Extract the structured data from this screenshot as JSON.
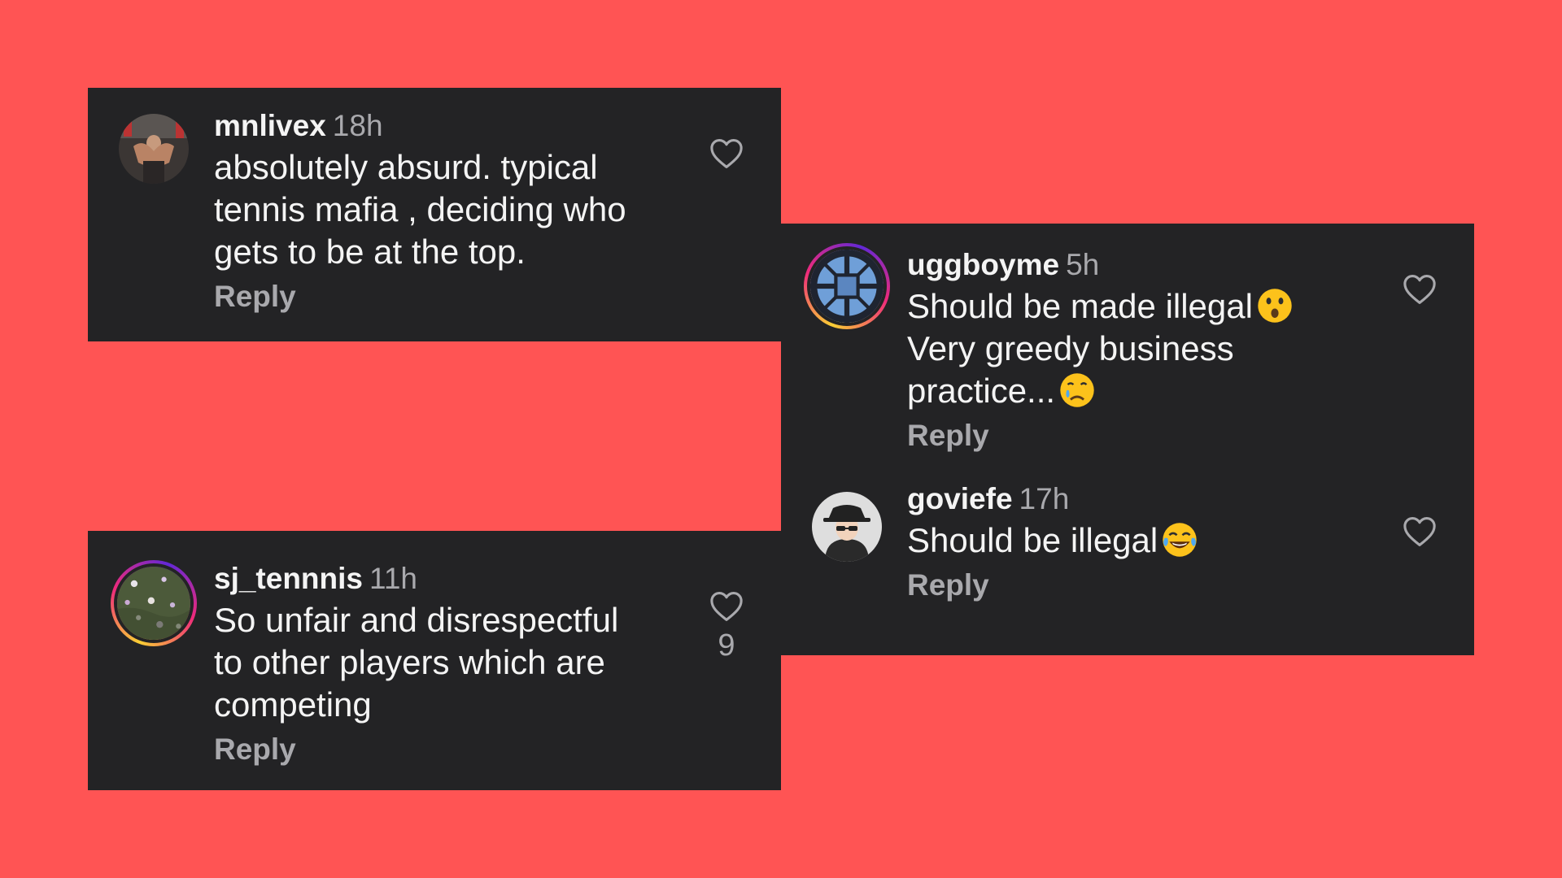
{
  "comments": [
    {
      "username": "mnlivex",
      "time": "18h",
      "text": "absolutely absurd. typical\ntennis mafia , deciding who\ngets to be at the top.",
      "reply_label": "Reply",
      "avatar_icon": "gym-photo-avatar"
    },
    {
      "username": "sj_tennnis",
      "time": "11h",
      "text": "So unfair and disrespectful\nto other players which are\ncompeting",
      "reply_label": "Reply",
      "like_count": "9",
      "avatar_icon": "flower-field-avatar"
    },
    {
      "username": "uggboyme",
      "time": "5h",
      "text_line1": "Should be made illegal",
      "text_line2": "Very greedy business",
      "text_line3": "practice...",
      "reply_label": "Reply",
      "emoji_1": "hushed-face-emoji",
      "emoji_2": "crying-face-emoji",
      "avatar_icon": "blue-window-avatar"
    },
    {
      "username": "goviefe",
      "time": "17h",
      "text": "Should be illegal",
      "reply_label": "Reply",
      "emoji_1": "tears-of-joy-emoji",
      "avatar_icon": "incognito-avatar"
    }
  ],
  "colors": {
    "background": "#ff5454",
    "card": "#232325",
    "text": "#f4f4f4",
    "secondary_text": "#a9a9ad"
  }
}
